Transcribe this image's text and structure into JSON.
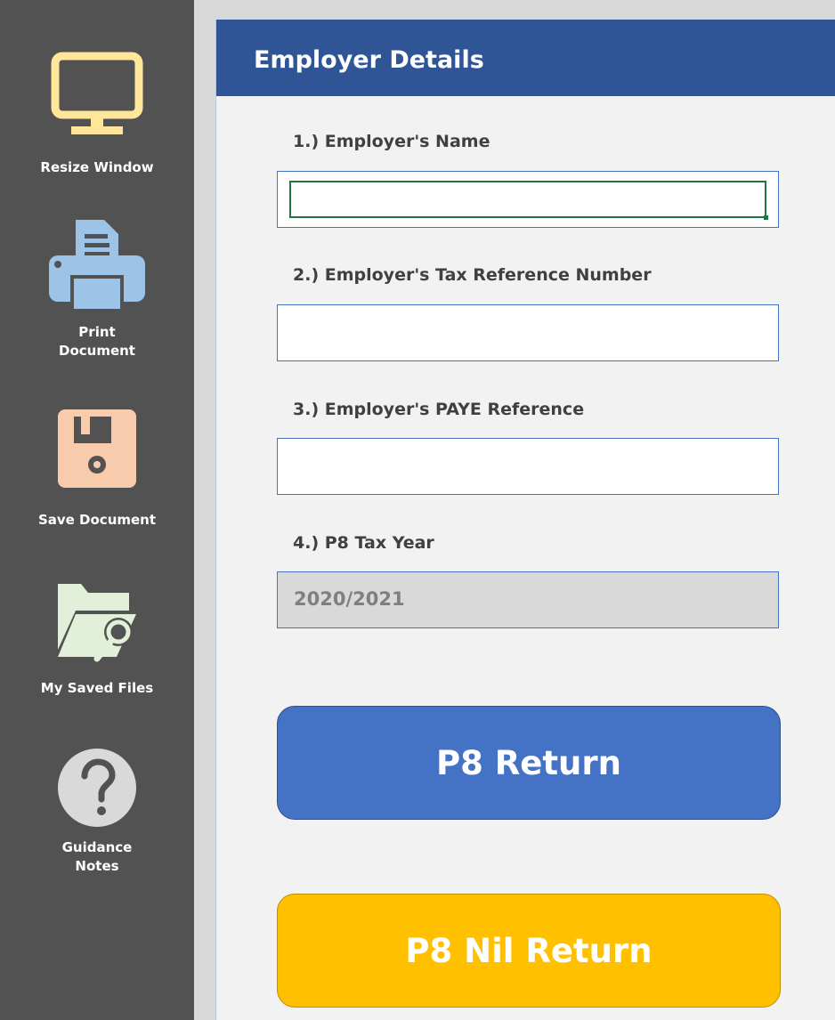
{
  "sidebar": {
    "items": [
      {
        "label": [
          "Resize Window"
        ],
        "icon": "monitor-icon"
      },
      {
        "label": [
          "Print",
          "Document"
        ],
        "icon": "printer-icon"
      },
      {
        "label": [
          "Save Document"
        ],
        "icon": "floppy-disk-icon"
      },
      {
        "label": [
          "My Saved Files"
        ],
        "icon": "folder-search-icon"
      },
      {
        "label": [
          "Guidance",
          "Notes"
        ],
        "icon": "question-icon"
      }
    ]
  },
  "panel": {
    "title": "Employer Details",
    "fields": [
      {
        "label": "1.) Employer's Name",
        "value": ""
      },
      {
        "label": "2.) Employer's Tax Reference Number",
        "value": ""
      },
      {
        "label": "3.) Employer's PAYE Reference",
        "value": ""
      },
      {
        "label": "4.) P8 Tax Year",
        "value": "2020/2021"
      }
    ],
    "buttons": {
      "p8_return": "P8 Return",
      "p8_nil_return": "P8 Nil Return"
    }
  },
  "colors": {
    "sidebar_bg": "#525252",
    "header_bg": "#2f5597",
    "primary_button": "#4472c4",
    "secondary_button": "#ffc000",
    "selection_border": "#217346"
  }
}
